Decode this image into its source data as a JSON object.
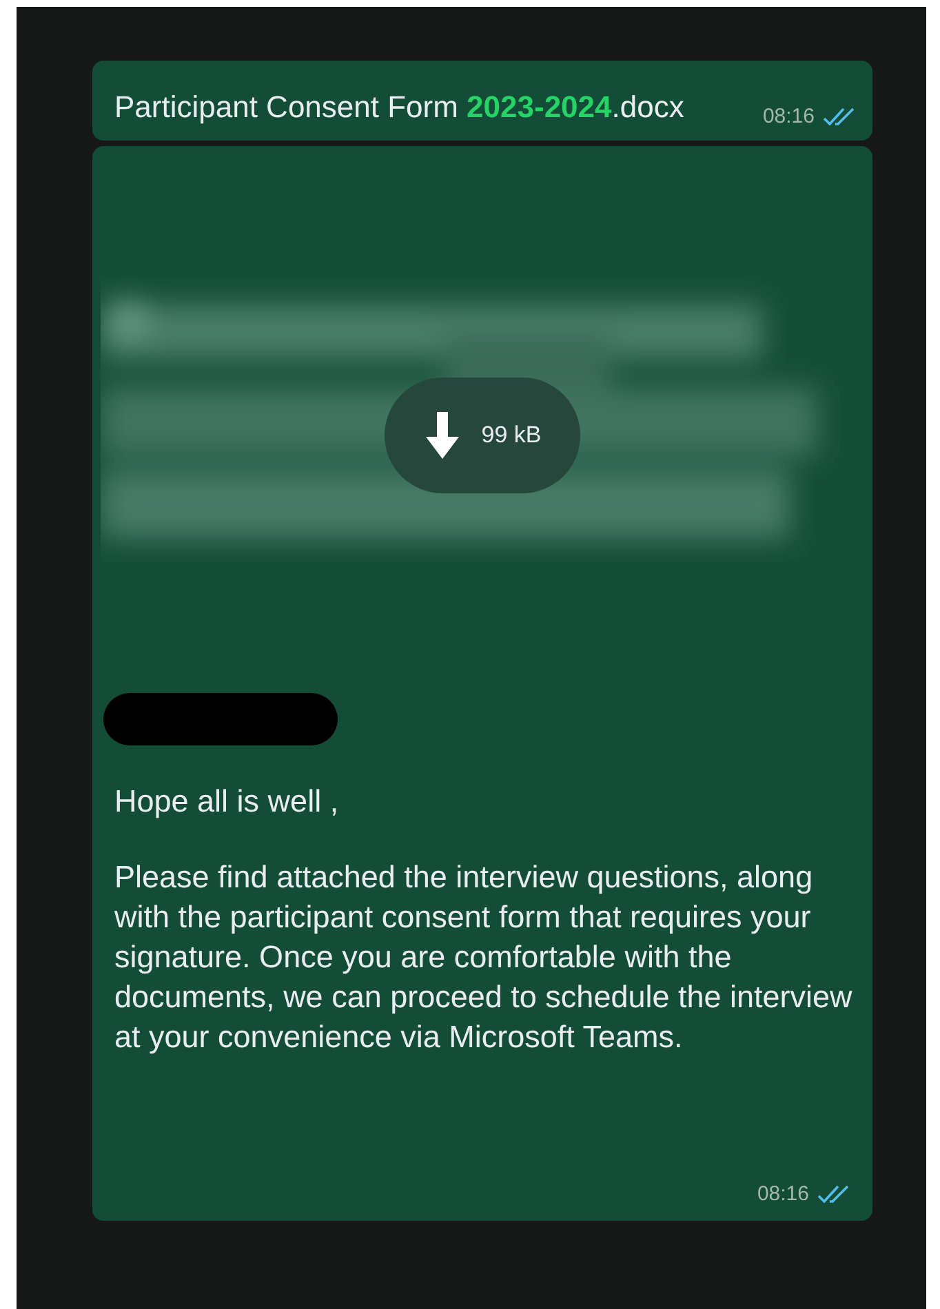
{
  "messages": [
    {
      "kind": "caption",
      "text": "Participant Consent Form **2023-2024**.docx",
      "time": "08:16",
      "read": true
    },
    {
      "kind": "attachment",
      "size": "99 kB",
      "redacted": true,
      "paragraphs": [
        "Hope all is well ,",
        "Please find attached the interview questions, along with the participant consent form that requires your signature. Once you are comfortable with the documents, we can proceed to schedule the interview at your convenience via Microsoft Teams."
      ],
      "time": "08:16",
      "read": true
    }
  ]
}
